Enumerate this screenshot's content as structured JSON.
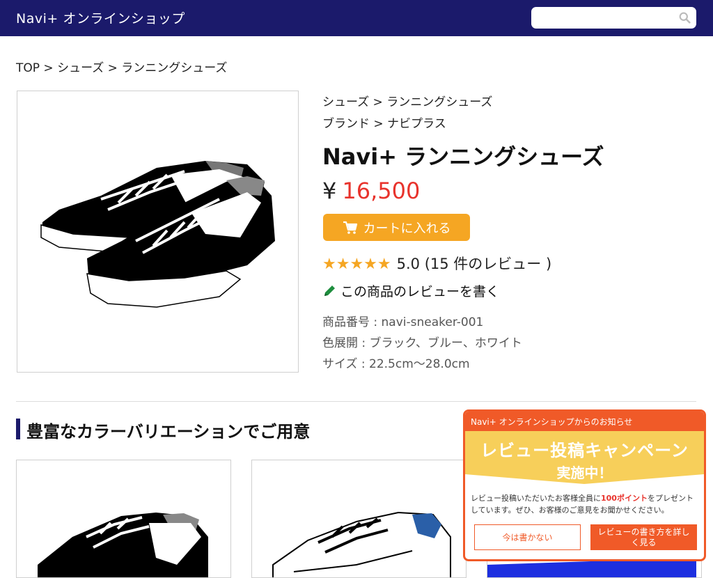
{
  "header": {
    "logo": "Navi+ オンラインショップ",
    "search_placeholder": "",
    "search_icon": "search-icon"
  },
  "breadcrumb": "TOP > シューズ > ランニングシューズ",
  "product": {
    "category_path": "シューズ > ランニングシューズ",
    "brand_path": "ブランド > ナビプラス",
    "name": "Navi+ ランニングシューズ",
    "currency": "¥",
    "price": "16,500",
    "cart_button": "カートに入れる",
    "stars": "★★★★★",
    "rating_text": "5.0 (15 件のレビュー )",
    "rating_value": 5.0,
    "write_review": "この商品のレビューを書く",
    "spec_number": "商品番号 : navi-sneaker-001",
    "spec_colors": "色展開 : ブラック、ブルー、ホワイト",
    "spec_size": "サイズ : 22.5cm〜28.0cm"
  },
  "section": {
    "title": "豊富なカラーバリエーションでご用意"
  },
  "popup": {
    "header": "Navi+ オンラインショップからのお知らせ",
    "banner_title": "レビュー投稿キャンペーン",
    "banner_sub": "実施中！",
    "text_before": "レビュー投稿いただいたお客様全員に",
    "text_points": "100ポイント",
    "text_after": "をプレゼントしています。ぜひ、お客様のご意見をお聞かせください。",
    "btn_later": "今は書かない",
    "btn_more": "レビューの書き方を詳しく見る"
  },
  "colors": {
    "header_bg": "#1b1a6b",
    "price": "#e8332c",
    "accent_orange": "#f5a623",
    "popup": "#f05a28",
    "banner_yellow": "#f7cf5a"
  }
}
